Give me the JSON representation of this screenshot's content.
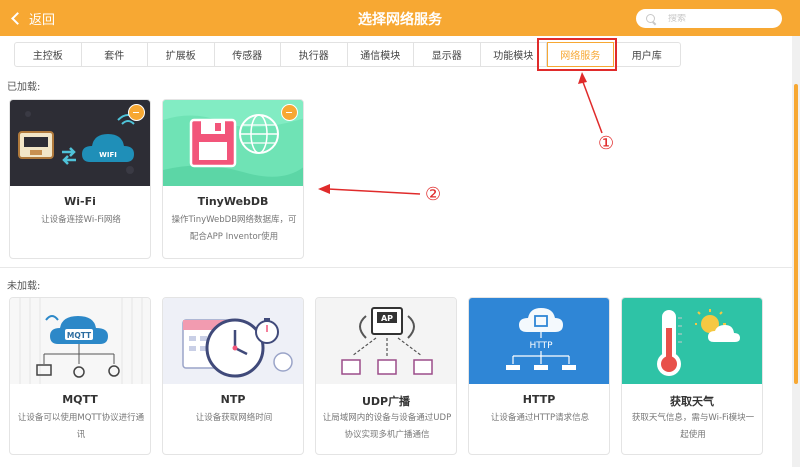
{
  "header": {
    "back_label": "返回",
    "title": "选择网络服务",
    "search_placeholder": "搜索"
  },
  "tabs": [
    {
      "label": "主控板",
      "active": false
    },
    {
      "label": "套件",
      "active": false
    },
    {
      "label": "扩展板",
      "active": false
    },
    {
      "label": "传感器",
      "active": false
    },
    {
      "label": "执行器",
      "active": false
    },
    {
      "label": "通信模块",
      "active": false
    },
    {
      "label": "显示器",
      "active": false
    },
    {
      "label": "功能模块",
      "active": false
    },
    {
      "label": "网络服务",
      "active": true
    },
    {
      "label": "用户库",
      "active": false
    }
  ],
  "loaded": {
    "label": "已加载:",
    "cards": [
      {
        "name": "Wi-Fi",
        "desc": "让设备连接Wi-Fi网络",
        "icon": "wifi-module-image"
      },
      {
        "name": "TinyWebDB",
        "desc": "操作TinyWebDB网络数据库，可配合APP Inventor使用",
        "icon": "database-globe-image"
      }
    ]
  },
  "unloaded": {
    "label": "未加载:",
    "cards": [
      {
        "name": "MQTT",
        "desc": "让设备可以使用MQTT协议进行通讯",
        "icon": "mqtt-cloud-image"
      },
      {
        "name": "NTP",
        "desc": "让设备获取网络时间",
        "icon": "clock-calendar-image"
      },
      {
        "name": "UDP广播",
        "desc": "让局域网内的设备与设备通过UDP协议实现多机广播通信",
        "icon": "access-point-image"
      },
      {
        "name": "HTTP",
        "desc": "让设备通过HTTP请求信息",
        "icon": "http-cloud-image"
      },
      {
        "name": "获取天气",
        "desc": "获取天气信息，需与Wi-Fi模块一起使用",
        "icon": "thermometer-weather-image"
      }
    ]
  },
  "http_image_text": "HTTP",
  "mqtt_image_text": "MQTT",
  "wifi_image_text": "WIFI",
  "ap_image_text": "AP",
  "annotations": {
    "one": "①",
    "two": "②"
  },
  "colors": {
    "accent": "#f7a833",
    "annotation": "#e02b2b"
  }
}
